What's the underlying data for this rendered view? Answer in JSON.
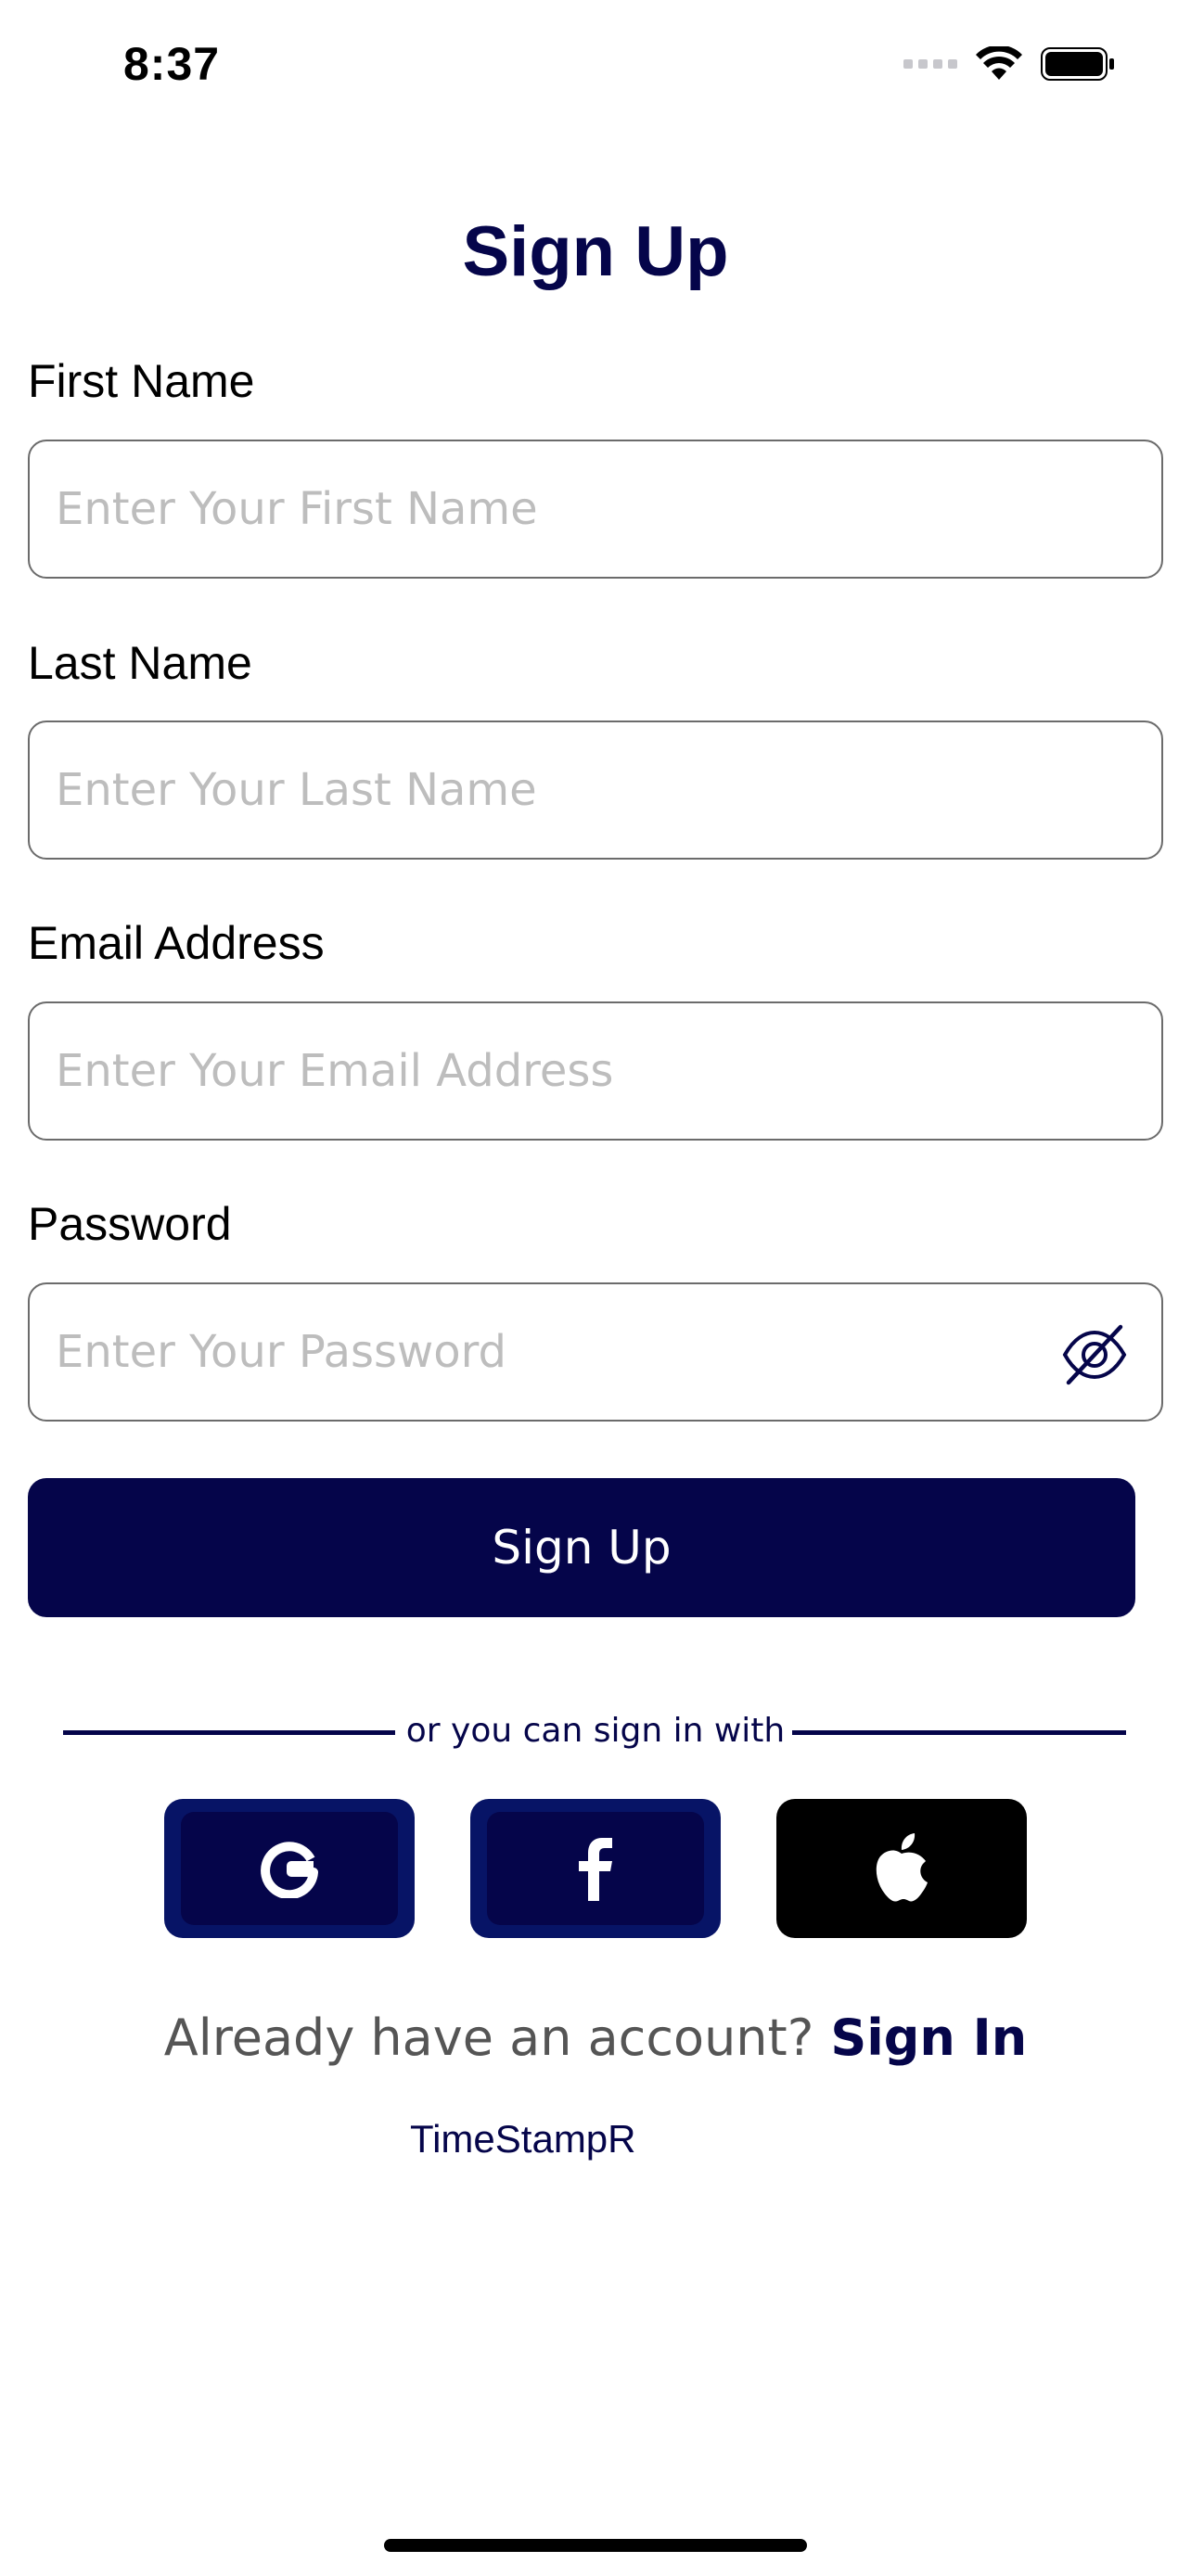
{
  "status_bar": {
    "time": "8:37"
  },
  "title": "Sign Up",
  "fields": {
    "first_name": {
      "label": "First Name",
      "placeholder": "Enter Your First Name",
      "value": ""
    },
    "last_name": {
      "label": "Last Name",
      "placeholder": "Enter Your Last Name",
      "value": ""
    },
    "email": {
      "label": "Email Address",
      "placeholder": "Enter Your Email Address",
      "value": ""
    },
    "password": {
      "label": "Password",
      "placeholder": "Enter Your Password",
      "value": ""
    }
  },
  "signup_button": "Sign Up",
  "divider_text": "or you can sign in with",
  "social": {
    "google_icon": "google-icon",
    "facebook_icon": "facebook-icon",
    "apple_icon": "apple-icon"
  },
  "account": {
    "question": "Already have an account?",
    "link": "Sign In"
  },
  "brand": "TimeStampR",
  "colors": {
    "primary": "#05054a",
    "social_border": "#071466",
    "apple": "#000000"
  }
}
